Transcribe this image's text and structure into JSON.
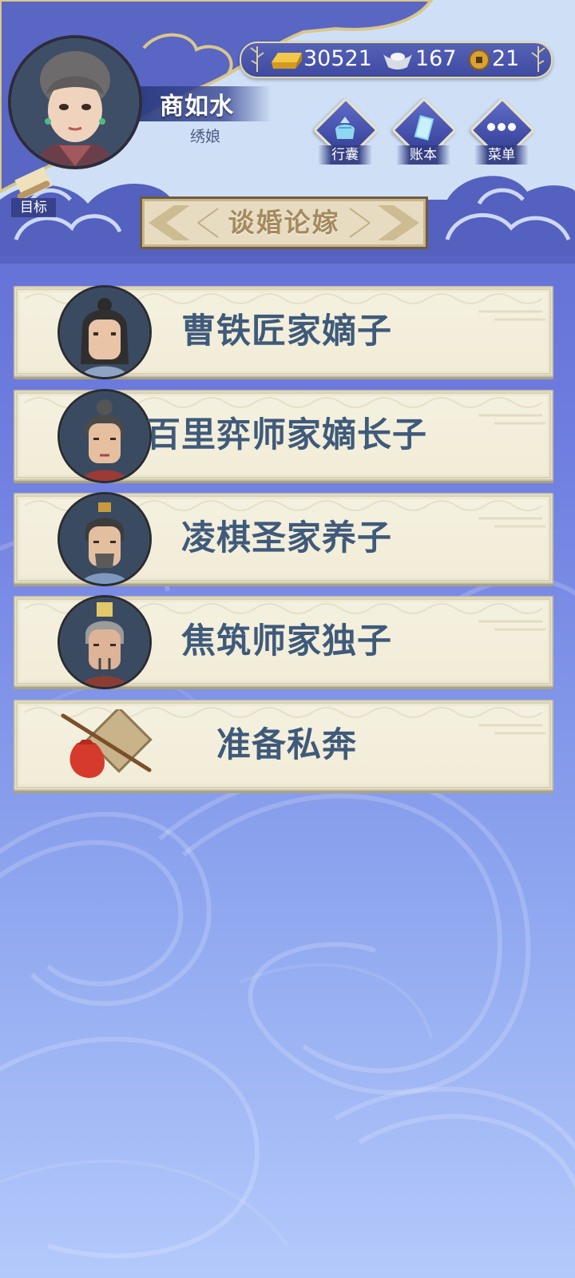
{
  "player": {
    "name": "商如水",
    "title": "绣娘"
  },
  "currency": {
    "gold": "30521",
    "silver": "167",
    "coin": "21"
  },
  "top_buttons": [
    {
      "label": "行囊",
      "icon": "bundle-icon"
    },
    {
      "label": "账本",
      "icon": "ledger-icon"
    },
    {
      "label": "菜单",
      "icon": "menu-dots-icon"
    }
  ],
  "goal": {
    "label": "目标",
    "icon": "scroll-icon"
  },
  "header": {
    "title": "谈婚论嫁"
  },
  "options": [
    {
      "label": "曹铁匠家嫡子",
      "icon": "suitor-portrait"
    },
    {
      "label": "百里弈师家嫡长子",
      "icon": "suitor-portrait"
    },
    {
      "label": "凌棋圣家养子",
      "icon": "suitor-portrait"
    },
    {
      "label": "焦筑师家独子",
      "icon": "suitor-portrait"
    },
    {
      "label": "准备私奔",
      "icon": "bindle-icon"
    }
  ],
  "colors": {
    "accent_blue": "#3f4aa1",
    "card_bg": "#f3efdc",
    "card_text": "#3f5a7a",
    "plaque_text": "#a58a5e"
  }
}
